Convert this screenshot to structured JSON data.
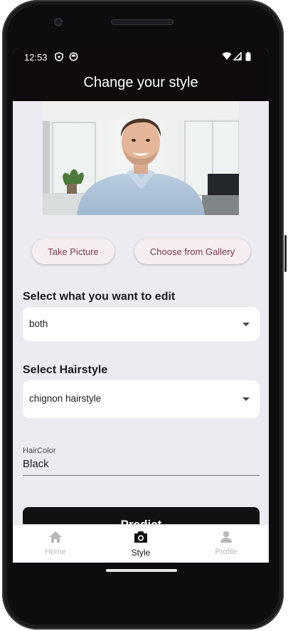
{
  "status_bar": {
    "time": "12:53",
    "icons": [
      "shield-icon",
      "sync-icon",
      "wifi-icon",
      "signal-icon",
      "battery-icon"
    ]
  },
  "app_bar": {
    "title": "Change your style"
  },
  "photo": {
    "subject": "man in light blue shirt smiling in office"
  },
  "buttons": {
    "take_picture": "Take Picture",
    "choose_gallery": "Choose from Gallery",
    "predict": "Predict"
  },
  "edit_section": {
    "label": "Select what you want to edit",
    "selected": "both"
  },
  "hairstyle_section": {
    "label": "Select Hairstyle",
    "selected": "chignon hairstyle"
  },
  "hair_color": {
    "label": "HairColor",
    "value": "Black"
  },
  "bottom_nav": {
    "items": [
      {
        "label": "Home",
        "icon": "home-icon",
        "active": false
      },
      {
        "label": "Style",
        "icon": "camera-icon",
        "active": true
      },
      {
        "label": "Profile",
        "icon": "person-icon",
        "active": false
      }
    ]
  },
  "colors": {
    "appbar": "#0f0a0c",
    "background": "#ecebf1",
    "button_bg": "#f6edf0",
    "button_text": "#7a3a4e",
    "predict_bg": "#111111"
  }
}
